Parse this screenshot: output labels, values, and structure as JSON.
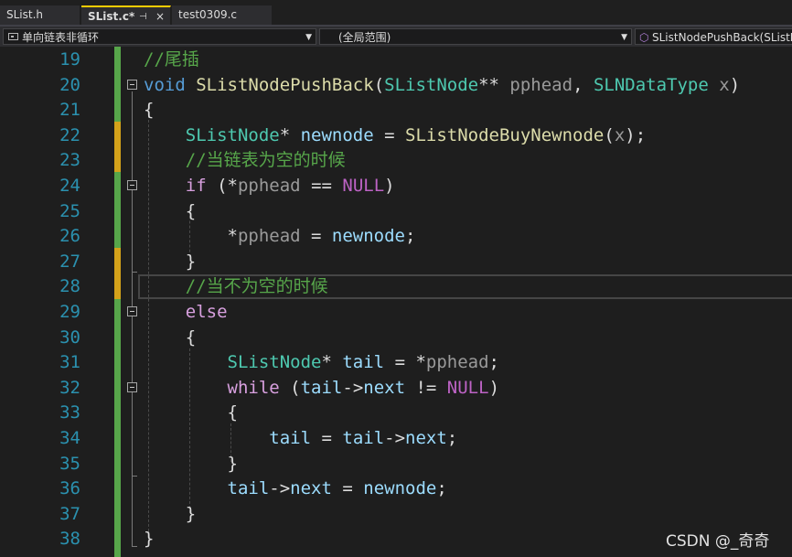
{
  "tabs": [
    {
      "label": "SList.h"
    },
    {
      "label": "SList.c*",
      "pin": "⊣",
      "close": "×"
    },
    {
      "label": "test0309.c"
    }
  ],
  "navbar": {
    "project": "单向链表非循环",
    "scope": "(全局范围)",
    "member": "SListNodePushBack(SListN"
  },
  "editor": {
    "line_numbers": [
      "19",
      "20",
      "21",
      "22",
      "23",
      "24",
      "25",
      "26",
      "27",
      "28",
      "29",
      "30",
      "31",
      "32",
      "33",
      "34",
      "35",
      "36",
      "37",
      "38"
    ],
    "lines": [
      [
        {
          "t": "//尾插",
          "c": "cm"
        }
      ],
      [
        {
          "t": "void",
          "c": "kw"
        },
        {
          "t": " ",
          "c": "pl"
        },
        {
          "t": "SListNodePushBack",
          "c": "fn"
        },
        {
          "t": "(",
          "c": "pl"
        },
        {
          "t": "SListNode",
          "c": "ty"
        },
        {
          "t": "** ",
          "c": "pl"
        },
        {
          "t": "pphead",
          "c": "prm"
        },
        {
          "t": ", ",
          "c": "pl"
        },
        {
          "t": "SLNDataType",
          "c": "ty"
        },
        {
          "t": " ",
          "c": "pl"
        },
        {
          "t": "x",
          "c": "prm"
        },
        {
          "t": ")",
          "c": "pl"
        }
      ],
      [
        {
          "t": "{",
          "c": "pl"
        }
      ],
      [
        {
          "t": "    ",
          "c": "pl"
        },
        {
          "t": "SListNode",
          "c": "ty"
        },
        {
          "t": "* ",
          "c": "pl"
        },
        {
          "t": "newnode",
          "c": "var"
        },
        {
          "t": " = ",
          "c": "pl"
        },
        {
          "t": "SListNodeBuyNewnode",
          "c": "fn"
        },
        {
          "t": "(",
          "c": "pl"
        },
        {
          "t": "x",
          "c": "prm"
        },
        {
          "t": ");",
          "c": "pl"
        }
      ],
      [
        {
          "t": "    ",
          "c": "pl"
        },
        {
          "t": "//当链表为空的时候",
          "c": "cm"
        }
      ],
      [
        {
          "t": "    ",
          "c": "pl"
        },
        {
          "t": "if",
          "c": "ctl"
        },
        {
          "t": " (*",
          "c": "pl"
        },
        {
          "t": "pphead",
          "c": "prm"
        },
        {
          "t": " == ",
          "c": "pl"
        },
        {
          "t": "NULL",
          "c": "mac"
        },
        {
          "t": ")",
          "c": "pl"
        }
      ],
      [
        {
          "t": "    {",
          "c": "pl"
        }
      ],
      [
        {
          "t": "        *",
          "c": "pl"
        },
        {
          "t": "pphead",
          "c": "prm"
        },
        {
          "t": " = ",
          "c": "pl"
        },
        {
          "t": "newnode",
          "c": "var"
        },
        {
          "t": ";",
          "c": "pl"
        }
      ],
      [
        {
          "t": "    }",
          "c": "pl"
        }
      ],
      [
        {
          "t": "    ",
          "c": "pl"
        },
        {
          "t": "//当不为空的时候",
          "c": "cm"
        }
      ],
      [
        {
          "t": "    ",
          "c": "pl"
        },
        {
          "t": "else",
          "c": "ctl"
        }
      ],
      [
        {
          "t": "    {",
          "c": "pl"
        }
      ],
      [
        {
          "t": "        ",
          "c": "pl"
        },
        {
          "t": "SListNode",
          "c": "ty"
        },
        {
          "t": "* ",
          "c": "pl"
        },
        {
          "t": "tail",
          "c": "var"
        },
        {
          "t": " = *",
          "c": "pl"
        },
        {
          "t": "pphead",
          "c": "prm"
        },
        {
          "t": ";",
          "c": "pl"
        }
      ],
      [
        {
          "t": "        ",
          "c": "pl"
        },
        {
          "t": "while",
          "c": "ctl"
        },
        {
          "t": " (",
          "c": "pl"
        },
        {
          "t": "tail",
          "c": "var"
        },
        {
          "t": "->",
          "c": "pl"
        },
        {
          "t": "next",
          "c": "var"
        },
        {
          "t": " != ",
          "c": "pl"
        },
        {
          "t": "NULL",
          "c": "mac"
        },
        {
          "t": ")",
          "c": "pl"
        }
      ],
      [
        {
          "t": "        {",
          "c": "pl"
        }
      ],
      [
        {
          "t": "            ",
          "c": "pl"
        },
        {
          "t": "tail",
          "c": "var"
        },
        {
          "t": " = ",
          "c": "pl"
        },
        {
          "t": "tail",
          "c": "var"
        },
        {
          "t": "->",
          "c": "pl"
        },
        {
          "t": "next",
          "c": "var"
        },
        {
          "t": ";",
          "c": "pl"
        }
      ],
      [
        {
          "t": "        }",
          "c": "pl"
        }
      ],
      [
        {
          "t": "        ",
          "c": "pl"
        },
        {
          "t": "tail",
          "c": "var"
        },
        {
          "t": "->",
          "c": "pl"
        },
        {
          "t": "next",
          "c": "var"
        },
        {
          "t": " = ",
          "c": "pl"
        },
        {
          "t": "newnode",
          "c": "var"
        },
        {
          "t": ";",
          "c": "pl"
        }
      ],
      [
        {
          "t": "    }",
          "c": "pl"
        }
      ],
      [
        {
          "t": "}",
          "c": "pl"
        }
      ]
    ]
  },
  "watermark": "CSDN @_奇奇",
  "colors": {
    "keyword": "#569cd6",
    "type": "#4ec9b0",
    "function": "#dcdcaa",
    "variable": "#9cdcfe",
    "parameter": "#9a9a9a",
    "comment": "#57a64a",
    "control": "#d8a0df",
    "macro": "#bd63c5",
    "line_number": "#2b91af",
    "change_saved": "#57a64a",
    "change_unsaved": "#d4a21a"
  }
}
